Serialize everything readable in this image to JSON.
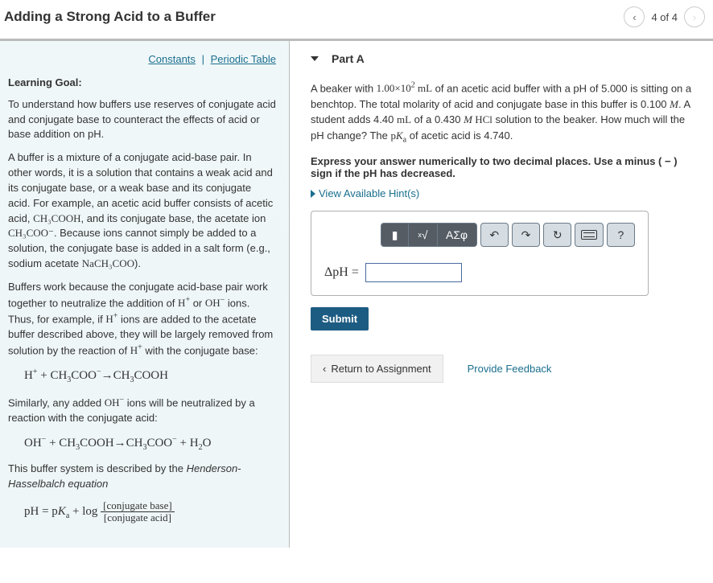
{
  "header": {
    "title": "Adding a Strong Acid to a Buffer",
    "page_label": "4 of 4"
  },
  "left": {
    "links": {
      "constants": "Constants",
      "periodic": "Periodic Table"
    },
    "learning_goal_heading": "Learning Goal:",
    "goal_text": "To understand how buffers use reserves of conjugate acid and conjugate base to counteract the effects of acid or base addition on pH.",
    "para1_a": "A buffer is a mixture of a conjugate acid-base pair. In other words, it is a solution that contains a weak acid and its conjugate base, or a weak base and its conjugate acid. For example, an acetic acid buffer consists of acetic acid, ",
    "para1_formula1": "CH₃COOH",
    "para1_b": ", and its conjugate base, the acetate ion ",
    "para1_formula2": "CH₃COO⁻",
    "para1_c": ". Because ions cannot simply be added to a solution, the conjugate base is added in a salt form (e.g., sodium acetate ",
    "para1_formula3": "NaCH₃COO",
    "para1_d": ").",
    "para2_a": "Buffers work because the conjugate acid-base pair work together to neutralize the addition of ",
    "para2_b": " or ",
    "para2_c": " ions. Thus, for example, if ",
    "para2_d": " ions are added to the acetate buffer described above, they will be largely removed from solution by the reaction of ",
    "para2_e": " with the conjugate base:",
    "eq1": "H⁺ + CH₃COO⁻ → CH₃COOH",
    "para3_a": "Similarly, any added ",
    "para3_b": " ions will be neutralized by a reaction with the conjugate acid:",
    "eq2": "OH⁻ + CH₃COOH → CH₃COO⁻ + H₂O",
    "para4": "This buffer system is described by the Henderson-Hasselbalch equation",
    "hheq_left": "pH = p",
    "hheq_ka": "K",
    "hheq_mid": " + log ",
    "hheq_num": "[conjugate base]",
    "hheq_den": "[conjugate acid]"
  },
  "right": {
    "part_label": "Part A",
    "q_a": "A beaker with ",
    "q_vol": "1.00×10² mL",
    "q_b": " of an acetic acid buffer with a pH of 5.000 is sitting on a benchtop. The total molarity of acid and conjugate base in this buffer is 0.100 ",
    "q_c": ". A student adds 4.40 ",
    "q_ml": "mL",
    "q_d": " of a 0.430 ",
    "q_m2": "M",
    "q_hcl": " HCl",
    "q_e": " solution to the beaker. How much will the pH change? The ",
    "q_pka": "pKₐ",
    "q_f": " of acetic acid is 4.740.",
    "instruction": "Express your answer numerically to two decimal places. Use a minus (  −  ) sign if the pH has decreased.",
    "hints_label": "View Available Hint(s)",
    "toolbar": {
      "tex": "▮",
      "root": "√",
      "greek": "ΑΣφ",
      "undo": "↶",
      "redo": "↷",
      "reset": "↻",
      "help": "?"
    },
    "answer_label": "ΔpH =",
    "answer_value": "",
    "submit": "Submit",
    "return_label": "Return to Assignment",
    "feedback": "Provide Feedback"
  }
}
